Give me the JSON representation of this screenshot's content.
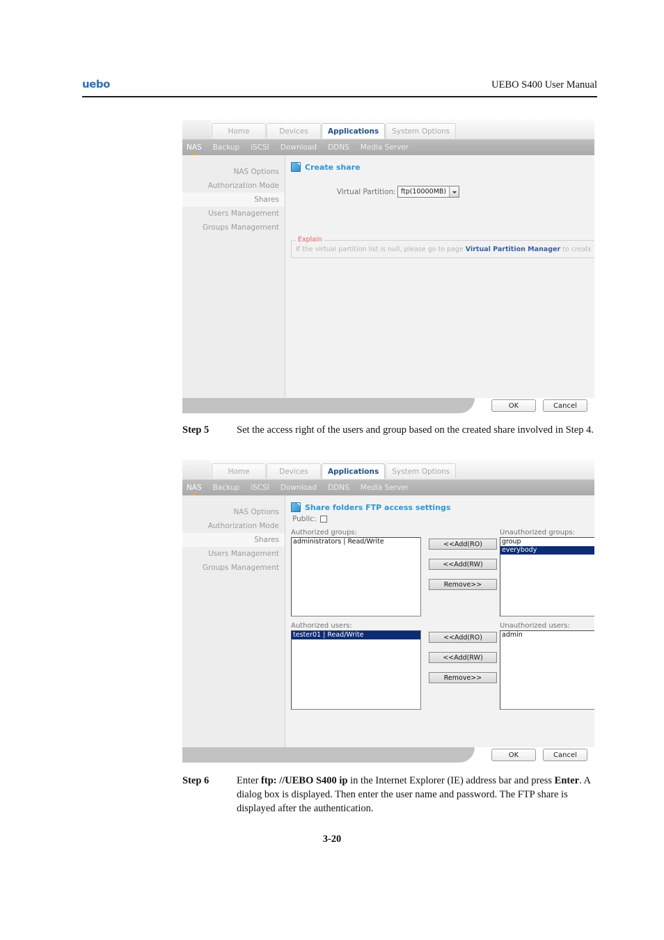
{
  "header": {
    "logo": "uebo",
    "title": "UEBO S400 User Manual"
  },
  "page_number": "3-20",
  "nav": {
    "tabs": [
      {
        "label": "Home",
        "active": false
      },
      {
        "label": "Devices",
        "active": false
      },
      {
        "label": "Applications",
        "active": true
      },
      {
        "label": "System Options",
        "active": false
      }
    ],
    "subnav": [
      {
        "label": "NAS",
        "active": true
      },
      {
        "label": "Backup",
        "active": false
      },
      {
        "label": "iSCSI",
        "active": false
      },
      {
        "label": "Download",
        "active": false
      },
      {
        "label": "DDNS",
        "active": false
      },
      {
        "label": "Media Server",
        "active": false
      }
    ],
    "sidebar": [
      {
        "label": "NAS Options",
        "active": false
      },
      {
        "label": "Authorization Mode",
        "active": false
      },
      {
        "label": "Shares",
        "active": true
      },
      {
        "label": "Users Management",
        "active": false
      },
      {
        "label": "Groups Management",
        "active": false
      }
    ]
  },
  "screenshot1": {
    "section_title": "Create share",
    "section_icon": "page-window-icon",
    "virtual_partition_label": "Virtual Partition:",
    "virtual_partition_value": "ftp(10000MB)",
    "explain_legend": "Explain",
    "explain_text_before": "If the virtual partition list is null, please go to page ",
    "explain_link": "Virtual Partition Manager",
    "explain_text_after": " to create a virtual",
    "ok_label": "OK",
    "cancel_label": "Cancel"
  },
  "screenshot2": {
    "section_title": "Share folders FTP access settings",
    "section_icon": "page-window-icon",
    "public_label": "Public:",
    "public_checked": false,
    "groups": {
      "authorized_label": "Authorized groups:",
      "unauthorized_label": "Unauthorized groups:",
      "authorized_items": [
        {
          "text": "administrators | Read/Write",
          "selected": false
        }
      ],
      "unauthorized_items": [
        {
          "text": "group",
          "selected": false
        },
        {
          "text": "everybody",
          "selected": true
        }
      ],
      "buttons": [
        "<<Add(RO)",
        "<<Add(RW)",
        "Remove>>"
      ]
    },
    "users": {
      "authorized_label": "Authorized users:",
      "unauthorized_label": "Unauthorized users:",
      "authorized_items": [
        {
          "text": "tester01 | Read/Write",
          "selected": true
        }
      ],
      "unauthorized_items": [
        {
          "text": "admin",
          "selected": false
        }
      ],
      "buttons": [
        "<<Add(RO)",
        "<<Add(RW)",
        "Remove>>"
      ]
    },
    "ok_label": "OK",
    "cancel_label": "Cancel"
  },
  "steps": [
    {
      "label": "Step 5",
      "parts": [
        {
          "text": "Set the access right of the users and group based on the created share involved in Step 4.",
          "bold": false
        }
      ]
    },
    {
      "label": "Step 6",
      "parts": [
        {
          "text": "Enter ",
          "bold": false
        },
        {
          "text": "ftp: //UEBO S400 ip",
          "bold": true
        },
        {
          "text": " in the Internet Explorer (IE) address bar and press ",
          "bold": false
        },
        {
          "text": "Enter",
          "bold": true
        },
        {
          "text": ". A dialog box is displayed. Then enter the user name and password. The FTP share is displayed after the authentication.",
          "bold": false
        }
      ]
    }
  ],
  "colors": {
    "link_blue": "#2a96d8",
    "active_tab_text": "#1f4e8c",
    "subnav_marker": "#f0a81e",
    "selection_blue": "#0b2c77",
    "explain_legend": "#e06060"
  }
}
